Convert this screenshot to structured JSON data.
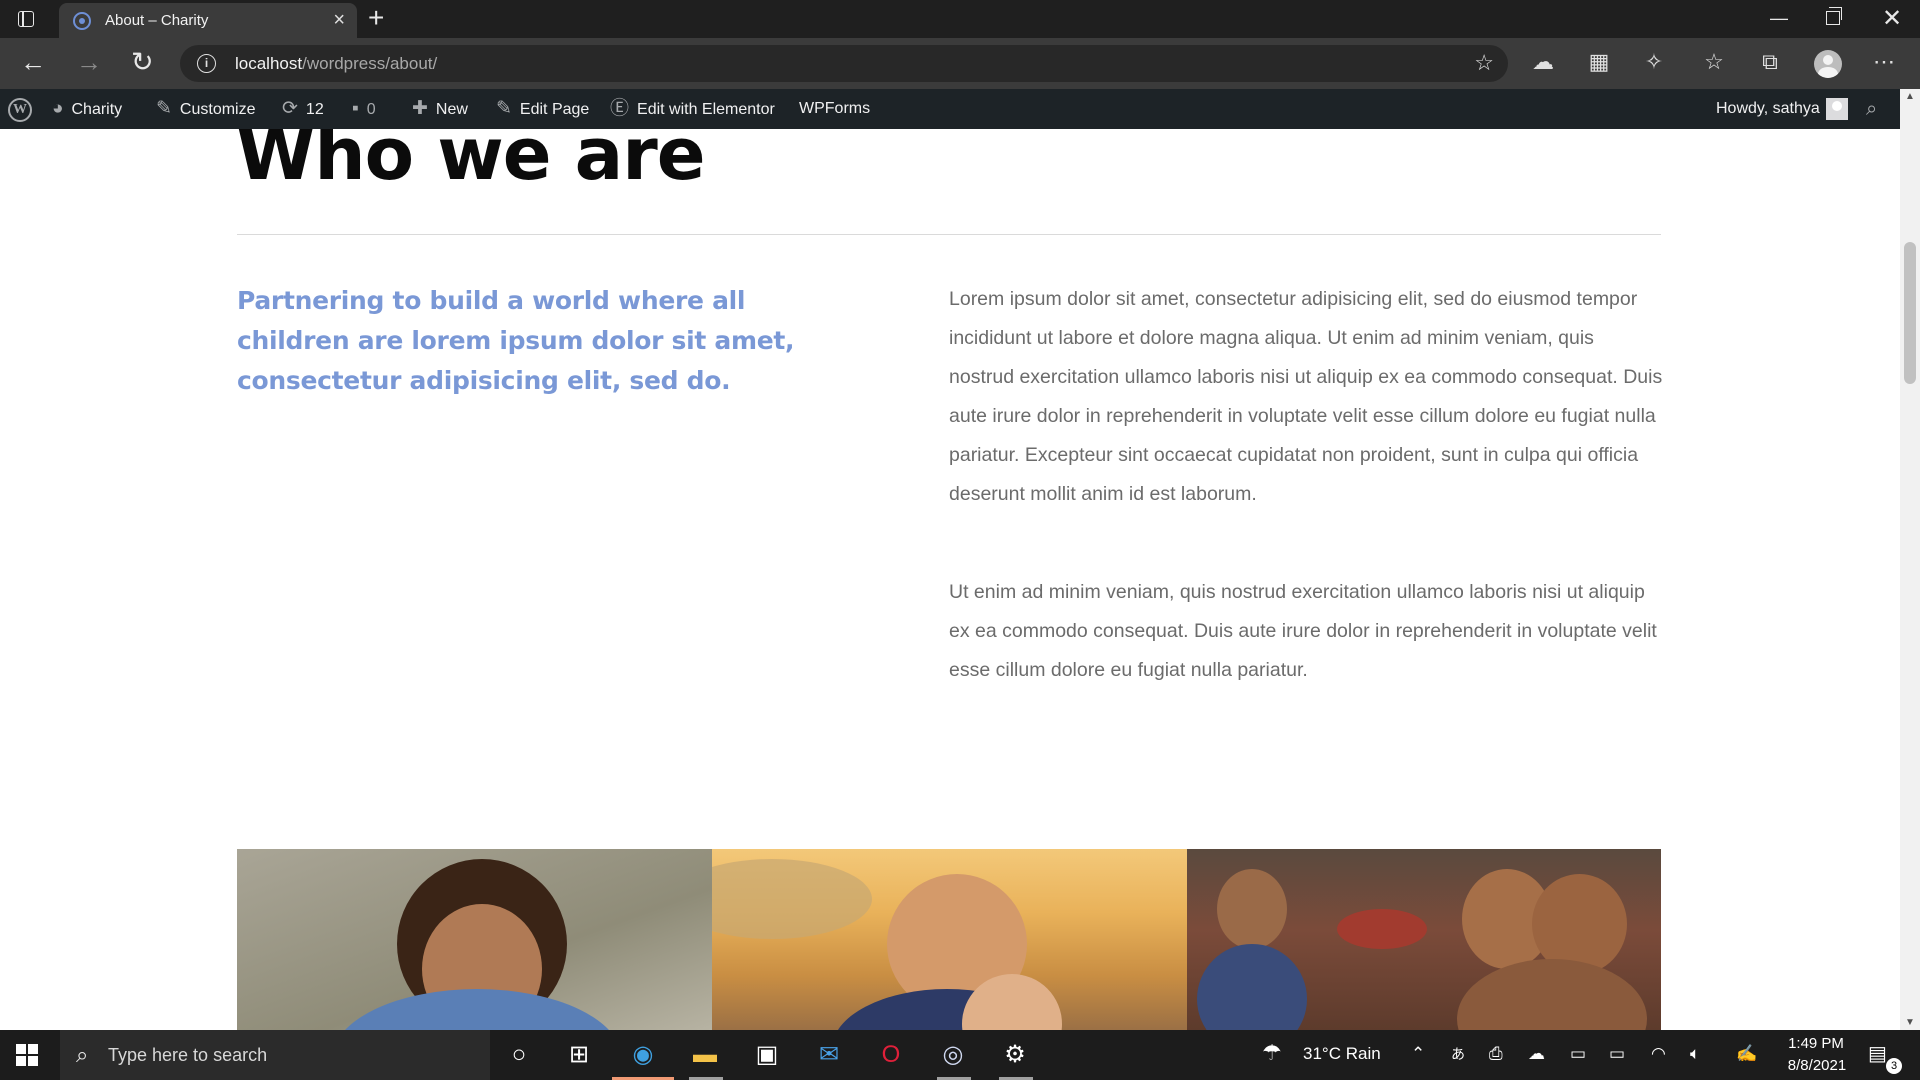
{
  "browser": {
    "tab_title": "About – Charity",
    "url_host": "localhost",
    "url_path": "/wordpress/about/"
  },
  "adminbar": {
    "site_name": "Charity",
    "customize": "Customize",
    "updates_count": "12",
    "comments_count": "0",
    "new_label": "New",
    "edit_page": "Edit Page",
    "elementor": "Edit with Elementor",
    "wpforms": "WPForms",
    "howdy": "Howdy, sathya"
  },
  "page": {
    "heading": "Who we are",
    "tagline": "Partnering to build a world where all children are lorem ipsum dolor sit amet, consectetur adipisicing elit, sed do.",
    "paragraph_1": "Lorem ipsum dolor sit amet, consectetur adipisicing elit, sed do eiusmod tempor incididunt ut labore et dolore magna aliqua. Ut enim ad minim veniam, quis nostrud exercitation ullamco laboris nisi ut aliquip ex ea commodo consequat. Duis aute irure dolor in reprehenderit in voluptate velit esse cillum dolore eu fugiat nulla pariatur. Excepteur sint occaecat cupidatat non proident, sunt in culpa qui officia deserunt mollit anim id est laborum.",
    "paragraph_2": "Ut enim ad minim veniam, quis nostrud exercitation ullamco laboris nisi ut aliquip ex ea commodo consequat. Duis aute irure dolor in reprehenderit in voluptate velit esse cillum dolore eu fugiat nulla pariatur."
  },
  "taskbar": {
    "search_placeholder": "Type here to search",
    "weather": "31°C  Rain",
    "time": "1:49 PM",
    "date": "8/8/2021",
    "notification_count": "3"
  },
  "colors": {
    "accent_blue": "#7a98d6",
    "adminbar_bg": "#1d2327",
    "taskbar_underline": "#f09a74"
  }
}
